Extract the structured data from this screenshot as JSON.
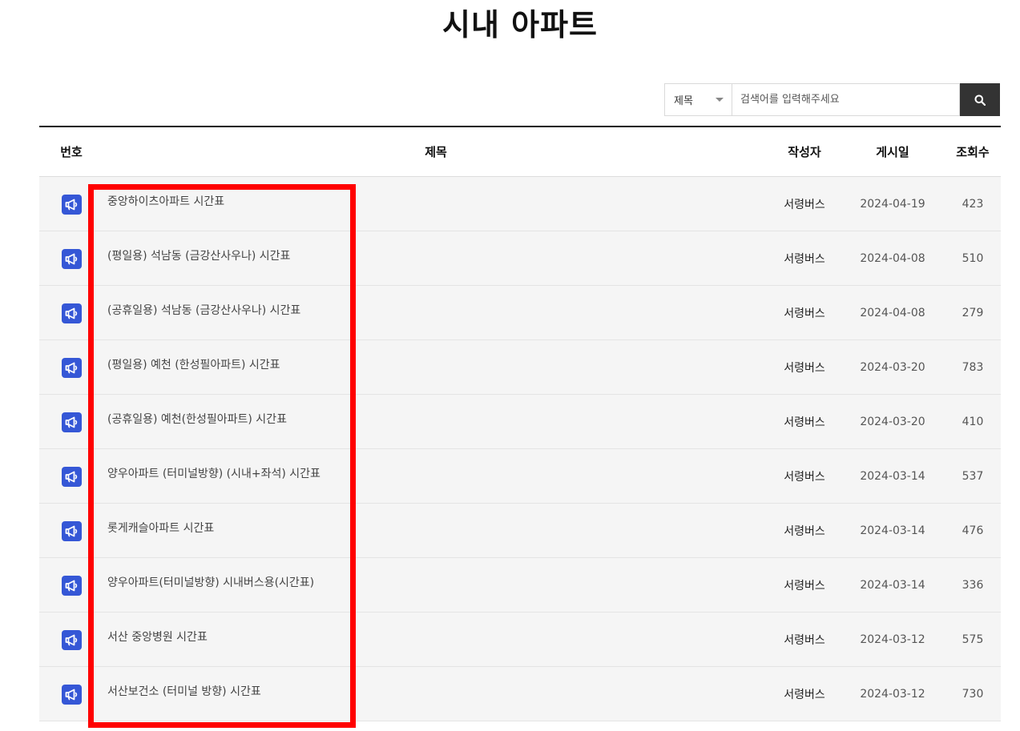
{
  "page": {
    "title": "시내 아파트"
  },
  "search": {
    "select_value": "제목",
    "placeholder": "검색어를 입력해주세요"
  },
  "table": {
    "headers": {
      "number": "번호",
      "title": "제목",
      "author": "작성자",
      "date": "게시일",
      "views": "조회수"
    },
    "rows": [
      {
        "icon": "notice-megaphone-icon",
        "title": "중앙하이츠아파트 시간표",
        "author": "서령버스",
        "date": "2024-04-19",
        "views": "423"
      },
      {
        "icon": "notice-megaphone-icon",
        "title": "(평일용) 석남동 (금강산사우나) 시간표",
        "author": "서령버스",
        "date": "2024-04-08",
        "views": "510"
      },
      {
        "icon": "notice-megaphone-icon",
        "title": "(공휴일용) 석남동 (금강산사우나) 시간표",
        "author": "서령버스",
        "date": "2024-04-08",
        "views": "279"
      },
      {
        "icon": "notice-megaphone-icon",
        "title": "(평일용) 예천 (한성필아파트) 시간표",
        "author": "서령버스",
        "date": "2024-03-20",
        "views": "783"
      },
      {
        "icon": "notice-megaphone-icon",
        "title": "(공휴일용) 예천(한성필아파트) 시간표",
        "author": "서령버스",
        "date": "2024-03-20",
        "views": "410"
      },
      {
        "icon": "notice-megaphone-icon",
        "title": "양우아파트 (터미널방향) (시내+좌석) 시간표",
        "author": "서령버스",
        "date": "2024-03-14",
        "views": "537"
      },
      {
        "icon": "notice-megaphone-icon",
        "title": "롯게캐슬아파트 시간표",
        "author": "서령버스",
        "date": "2024-03-14",
        "views": "476"
      },
      {
        "icon": "notice-megaphone-icon",
        "title": "양우아파트(터미널방향) 시내버스용(시간표)",
        "author": "서령버스",
        "date": "2024-03-14",
        "views": "336"
      },
      {
        "icon": "notice-megaphone-icon",
        "title": "서산 중앙병원 시간표",
        "author": "서령버스",
        "date": "2024-03-12",
        "views": "575"
      },
      {
        "icon": "notice-megaphone-icon",
        "title": "서산보건소 (터미널 방향) 시간표",
        "author": "서령버스",
        "date": "2024-03-12",
        "views": "730"
      }
    ]
  },
  "colors": {
    "notice_icon_bg": "#3557d6",
    "highlight_border": "#ff0000",
    "search_button_bg": "#333333"
  }
}
